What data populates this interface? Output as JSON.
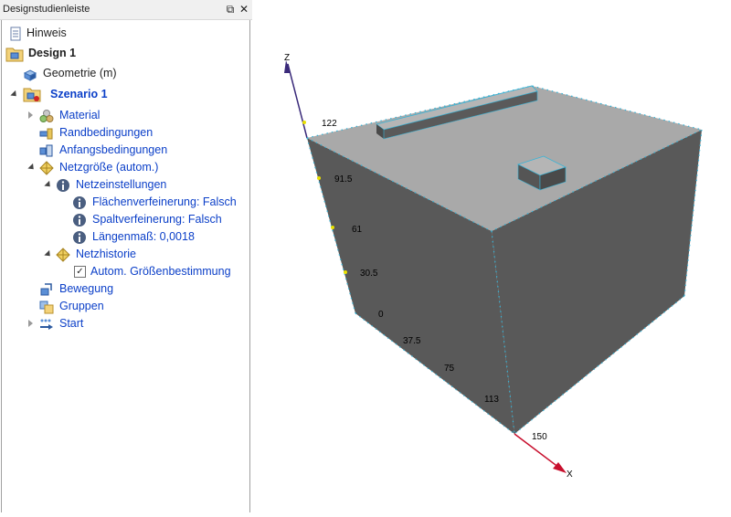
{
  "panel": {
    "title": "Designstudienleiste",
    "float_icon": "restore-window-icon",
    "close_icon": "close-icon"
  },
  "tree": {
    "hinweis": "Hinweis",
    "design": "Design 1",
    "geometrie": "Geometrie (m)",
    "szenario": "Szenario 1",
    "material": "Material",
    "randbedingungen": "Randbedingungen",
    "anfangsbedingungen": "Anfangsbedingungen",
    "netzgroesse": "Netzgröße (autom.)",
    "netzeinstellungen": "Netzeinstellungen",
    "flaechenverfeinerung": "Flächenverfeinerung: Falsch",
    "spaltverfeinerung": "Spaltverfeinerung: Falsch",
    "laengenmass": "Längenmaß: 0,0018",
    "netzhistorie": "Netzhistorie",
    "autom_groessen": "Autom. Größenbestimmung",
    "autom_checked": "✓",
    "bewegung": "Bewegung",
    "gruppen": "Gruppen",
    "start": "Start"
  },
  "viewport": {
    "axis_z_label": "Z",
    "axis_x_label": "X",
    "z_ticks": [
      "122",
      "91.5",
      "61",
      "30.5",
      "0"
    ],
    "x_ticks": [
      "37.5",
      "75",
      "113",
      "150"
    ],
    "colors": {
      "side_face": "#595959",
      "top_face": "#a9a9a9",
      "mesh_edge": "#35b4d8",
      "z_axis": "#3a2a7a",
      "x_axis": "#c8102e",
      "tree_link": "#0b3fc8"
    }
  }
}
